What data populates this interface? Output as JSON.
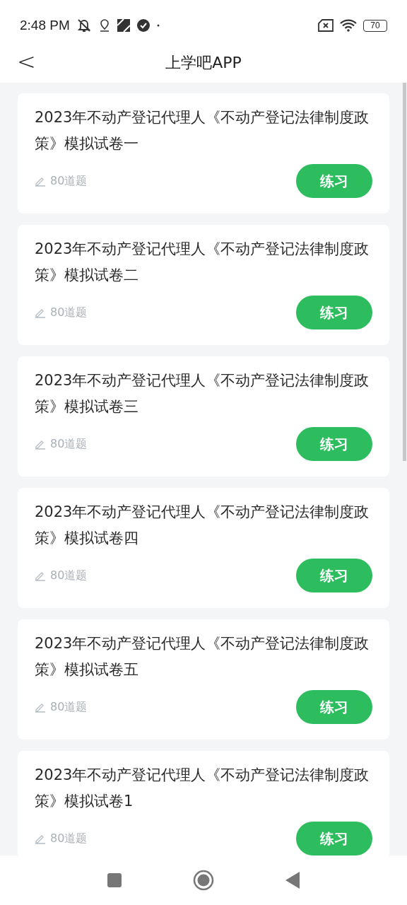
{
  "status_bar": {
    "time": "2:48 PM",
    "battery": "70"
  },
  "header": {
    "back": "<",
    "title": "上学吧APP"
  },
  "papers": [
    {
      "title": "2023年不动产登记代理人《不动产登记法律制度政策》模拟试卷一",
      "count": "80道题",
      "action": "练习"
    },
    {
      "title": "2023年不动产登记代理人《不动产登记法律制度政策》模拟试卷二",
      "count": "80道题",
      "action": "练习"
    },
    {
      "title": "2023年不动产登记代理人《不动产登记法律制度政策》模拟试卷三",
      "count": "80道题",
      "action": "练习"
    },
    {
      "title": "2023年不动产登记代理人《不动产登记法律制度政策》模拟试卷四",
      "count": "80道题",
      "action": "练习"
    },
    {
      "title": "2023年不动产登记代理人《不动产登记法律制度政策》模拟试卷五",
      "count": "80道题",
      "action": "练习"
    },
    {
      "title": "2023年不动产登记代理人《不动产登记法律制度政策》模拟试卷1",
      "count": "80道题",
      "action": "练习"
    }
  ]
}
